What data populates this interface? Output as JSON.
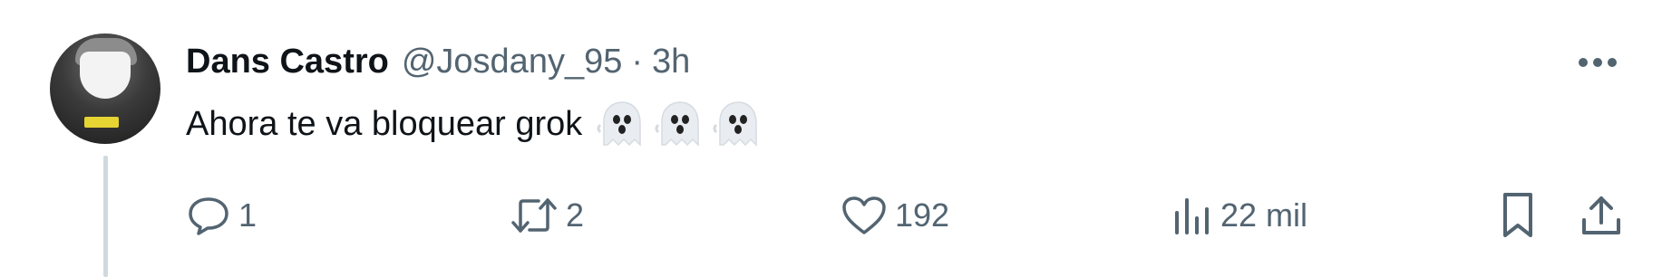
{
  "tweet": {
    "display_name": "Dans Castro",
    "handle": "@Josdany_95",
    "separator": "·",
    "time": "3h",
    "text": "Ahora te va bloquear grok",
    "emoji": [
      "ghost-icon",
      "ghost-icon",
      "ghost-icon"
    ]
  },
  "actions": {
    "replies": "1",
    "retweets": "2",
    "likes": "192",
    "views": "22 mil"
  },
  "colors": {
    "text_primary": "#0f1419",
    "text_secondary": "#536471",
    "thread_line": "#cfd9de",
    "background": "#ffffff"
  },
  "icons": {
    "more": "ellipsis-icon",
    "reply": "reply-icon",
    "retweet": "retweet-icon",
    "like": "heart-icon",
    "views": "views-bar-chart-icon",
    "bookmark": "bookmark-icon",
    "share": "share-icon"
  }
}
